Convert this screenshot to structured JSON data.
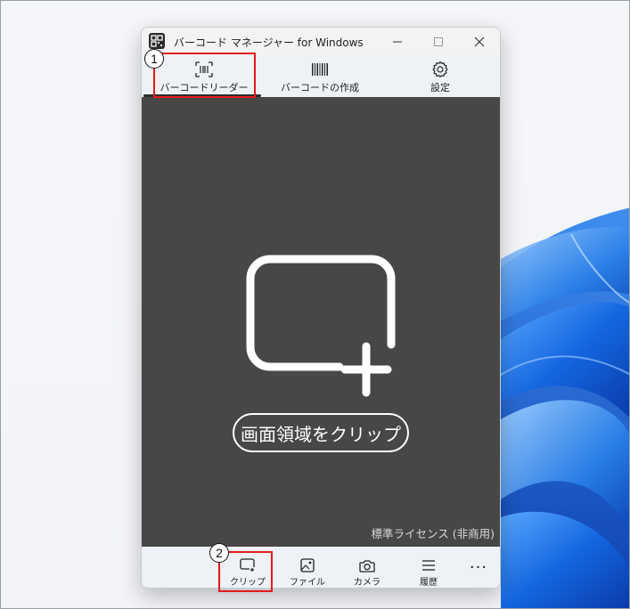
{
  "window": {
    "title": "バーコード マネージャー for Windows",
    "controls": [
      "minimize-icon",
      "maximize-icon",
      "close-icon"
    ]
  },
  "nav": {
    "tabs": [
      {
        "label": "バーコードリーダー",
        "icon": "barcode-scan-icon",
        "selected": true
      },
      {
        "label": "バーコードの作成",
        "icon": "barcode-icon",
        "selected": false
      },
      {
        "label": "設定",
        "icon": "gear-icon",
        "selected": false
      }
    ]
  },
  "capture": {
    "action_label": "画面領域をクリップ",
    "icon": "clip-add-icon",
    "license": "標準ライセンス (非商用)"
  },
  "bottom": {
    "items": [
      {
        "label": "クリップ",
        "icon": "clip-icon"
      },
      {
        "label": "ファイル",
        "icon": "image-file-icon"
      },
      {
        "label": "カメラ",
        "icon": "camera-icon"
      },
      {
        "label": "履歴",
        "icon": "history-icon"
      }
    ],
    "more": "···"
  },
  "callouts": [
    {
      "number": "1",
      "target": "バーコードリーダー"
    },
    {
      "number": "2",
      "target": "クリップ"
    }
  ],
  "colors": {
    "capture_bg": "#484745",
    "callout_red": "#e31b1b",
    "wallpaper_blue": "#1464d6"
  }
}
